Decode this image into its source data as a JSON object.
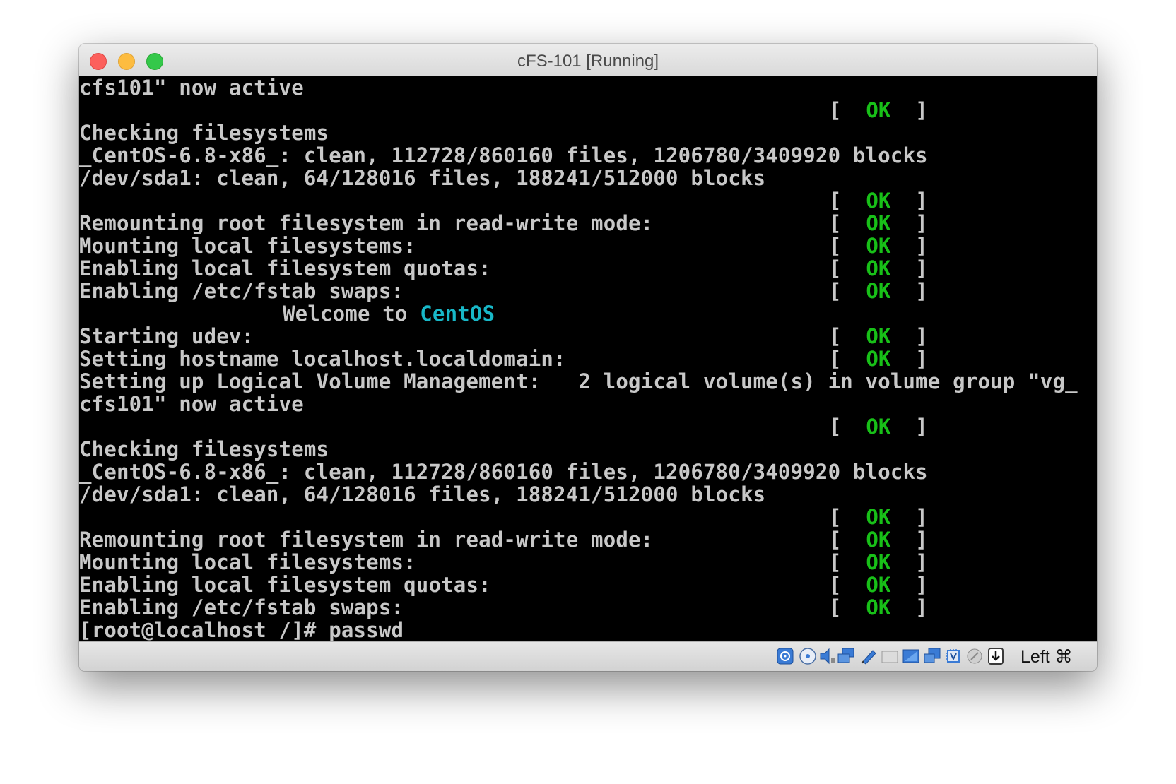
{
  "window": {
    "title": "cFS-101 [Running]"
  },
  "terminal": {
    "lines": [
      "cfs101\" now active",
      "",
      "Checking filesystems",
      "_CentOS-6.8-x86_: clean, 112728/860160 files, 1206780/3409920 blocks",
      "/dev/sda1: clean, 64/128016 files, 188241/512000 blocks",
      "",
      "Remounting root filesystem in read-write mode:",
      "Mounting local filesystems:",
      "Enabling local filesystem quotas:",
      "Enabling /etc/fstab swaps:",
      "",
      "Starting udev:",
      "Setting hostname localhost.localdomain:",
      "Setting up Logical Volume Management:   2 logical volume(s) in volume group \"vg_",
      "cfs101\" now active",
      "",
      "Checking filesystems",
      "_CentOS-6.8-x86_: clean, 112728/860160 files, 1206780/3409920 blocks",
      "/dev/sda1: clean, 64/128016 files, 188241/512000 blocks",
      "",
      "Remounting root filesystem in read-write mode:",
      "Mounting local filesystems:",
      "Enabling local filesystem quotas:",
      "Enabling /etc/fstab swaps:",
      "[root@localhost /]# passwd"
    ],
    "welcome_prefix": "Welcome to ",
    "welcome_brand": "CentOS",
    "ok_open": "[  ",
    "ok_label": "OK",
    "ok_close": "  ]",
    "prompt_line": "[root@localhost /]# passwd"
  },
  "statusbar": {
    "host_key": "Left ⌘",
    "icons": [
      "hard-disk-icon",
      "optical-disk-icon",
      "audio-icon",
      "network-icon",
      "usb-icon",
      "shared-folders-icon",
      "display-icon",
      "video-capture-icon",
      "cpu-icon",
      "mouse-integration-icon",
      "keyboard-capture-icon"
    ]
  },
  "colors": {
    "ok": "#18c018",
    "brand": "#18b8c8",
    "terminal_text": "#c8c8c8",
    "terminal_bg": "#000000"
  }
}
